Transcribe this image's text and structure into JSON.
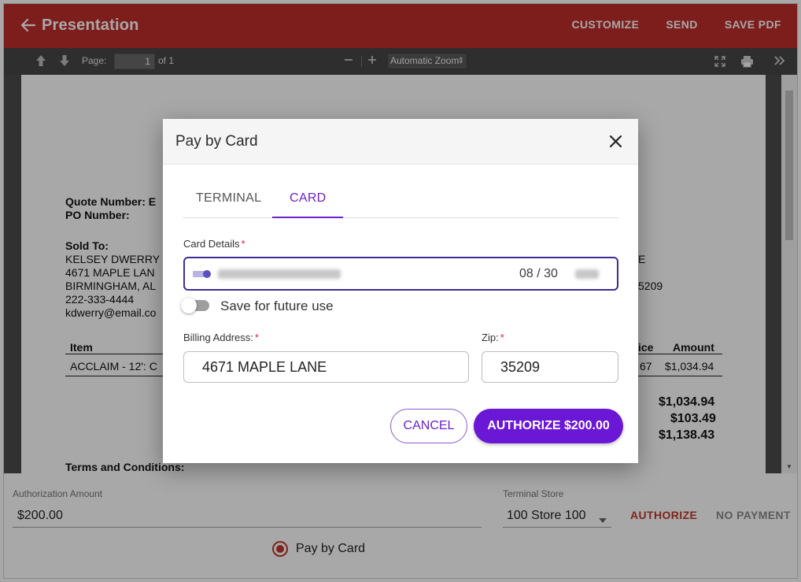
{
  "header": {
    "title": "Presentation",
    "actions": [
      "CUSTOMIZE",
      "SEND",
      "SAVE PDF"
    ]
  },
  "pdf_toolbar": {
    "page_label": "Page:",
    "page_value": "1",
    "page_total": "of 1",
    "zoom_label": "Automatic Zoom"
  },
  "document": {
    "quote_number_label": "Quote Number: E",
    "po_number_label": "PO Number:",
    "sold_to_label": "Sold To:",
    "sold_to_lines": [
      "KELSEY DWERRY",
      "4671 MAPLE LAN",
      "BIRMINGHAM, AL",
      "222-333-4444",
      "kdwerry@email.co"
    ],
    "right_fragment_1": "E",
    "right_fragment_2": "5209",
    "table_item_header": "Item",
    "table_price_header": "ice",
    "table_amount_header": "Amount",
    "row_item": "ACCLAIM - 12': C",
    "row_price": "67",
    "row_amount": "$1,034.94",
    "subtotal": "$1,034.94",
    "tax": "$103.49",
    "total": "$1,138.43",
    "terms_label": "Terms and Conditions:"
  },
  "bottom_panel": {
    "auth_amount_label": "Authorization Amount",
    "auth_amount_value": "$200.00",
    "terminal_store_label": "Terminal Store",
    "terminal_store_value": "100 Store 100",
    "authorize_label": "AUTHORIZE",
    "no_payment_label": "NO PAYMENT",
    "pay_by_card_label": "Pay by Card"
  },
  "modal": {
    "title": "Pay by Card",
    "tabs": [
      {
        "label": "TERMINAL",
        "active": false
      },
      {
        "label": "CARD",
        "active": true
      }
    ],
    "card_details_label": "Card Details",
    "required_mark": "*",
    "card_expiry": "08 / 30",
    "save_future_label": "Save for future use",
    "billing_address_label": "Billing Address:",
    "billing_address_value": "4671 MAPLE LANE",
    "zip_label": "Zip:",
    "zip_value": "35209",
    "cancel_label": "CANCEL",
    "authorize_label": "AUTHORIZE $200.00"
  },
  "colors": {
    "header_red": "#be2e2c",
    "accent_purple": "#6a22c8",
    "authorize_red": "#c0392b"
  }
}
